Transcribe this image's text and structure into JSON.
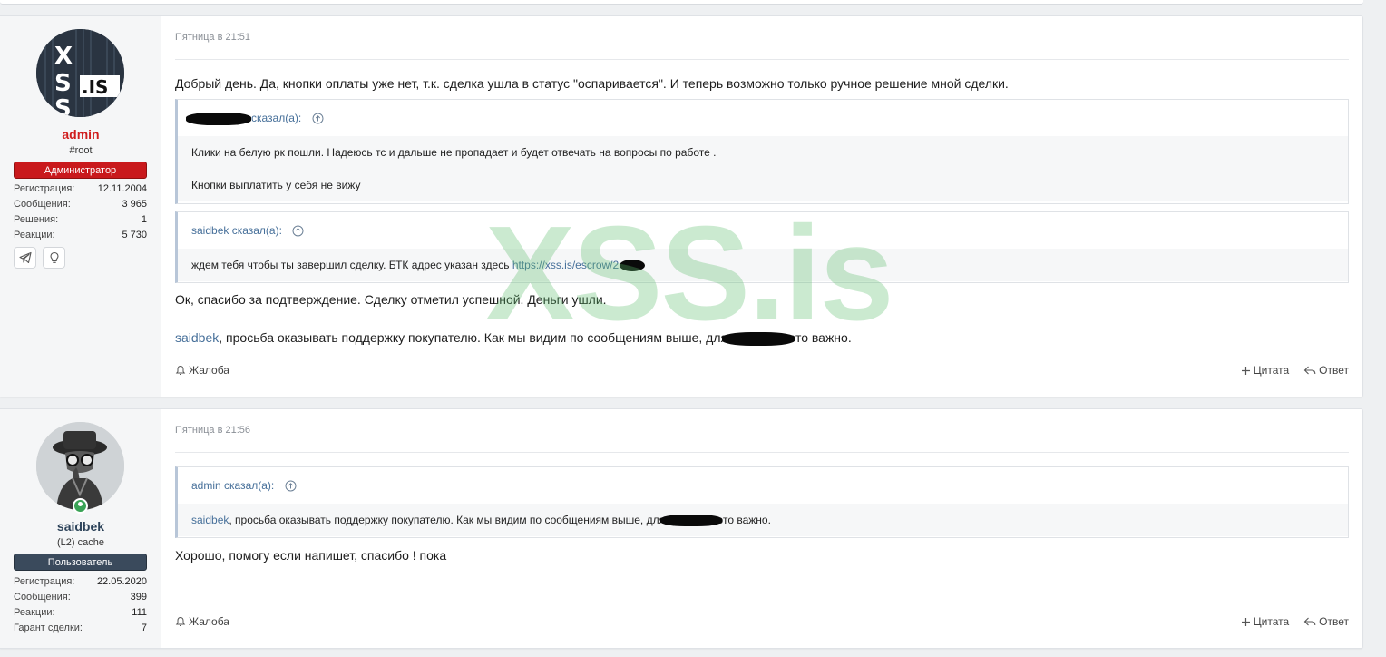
{
  "watermark": "XSS.is",
  "posts": [
    {
      "user": {
        "name": "admin",
        "title": "#root",
        "role": "Администратор",
        "avatar_text": ".IS",
        "stats": [
          {
            "label": "Регистрация:",
            "value": "12.11.2004"
          },
          {
            "label": "Сообщения:",
            "value": "3 965"
          },
          {
            "label": "Решения:",
            "value": "1"
          },
          {
            "label": "Реакции:",
            "value": "5 730"
          }
        ],
        "contact_icons": [
          "telegram-icon",
          "lightbulb-icon"
        ]
      },
      "time": "Пятница в 21:51",
      "text1": "Добрый день. Да, кнопки оплаты уже нет, т.к. сделка ушла в статус \"оспаривается\". И теперь возможно только ручное решение мной сделки.",
      "quote1": {
        "author": "сказал(а):",
        "line1": "Клики на белую рк пошли. Надеюсь тс и дальше не пропадает и будет отвечать на вопросы по работе .",
        "line2": "Кнопки выплатить у себя не вижу"
      },
      "quote2": {
        "author": "saidbek сказал(а):",
        "line1": "ждем тебя чтобы ты завершил сделку. БТК адрес указан здесь ",
        "link": "https://xss.is/escrow/2"
      },
      "text2": "Ок, спасибо за подтверждение. Сделку отметил успешной. Деньги ушли.",
      "text3_mention": "saidbek",
      "text3_a": ", просьба оказывать поддержку покупателю. Как мы видим по сообщениям выше, для",
      "text3_b": "это важно.",
      "report": "Жалоба",
      "quote_action": "Цитата",
      "reply": "Ответ"
    },
    {
      "user": {
        "name": "saidbek",
        "title": "(L2) cache",
        "role": "Пользователь",
        "stats": [
          {
            "label": "Регистрация:",
            "value": "22.05.2020"
          },
          {
            "label": "Сообщения:",
            "value": "399"
          },
          {
            "label": "Реакции:",
            "value": "111"
          },
          {
            "label": "Гарант сделки:",
            "value": "7"
          }
        ]
      },
      "time": "Пятница в 21:56",
      "quote1": {
        "author": "admin сказал(а):",
        "mention": "saidbek",
        "line_a": ", просьба оказывать поддержку покупателю. Как мы видим по сообщениям выше, для",
        "line_b": "это важно."
      },
      "text1": "Хорошо, помогу если напишет, спасибо ! пока",
      "report": "Жалоба",
      "quote_action": "Цитата",
      "reply": "Ответ"
    }
  ],
  "colors": {
    "admin_name": "#d01e1e",
    "admin_badge": "#c9191c",
    "user_badge": "#3a4a5c",
    "link": "#47709a",
    "watermark": "#5cbe6e",
    "online": "#3aa356"
  }
}
